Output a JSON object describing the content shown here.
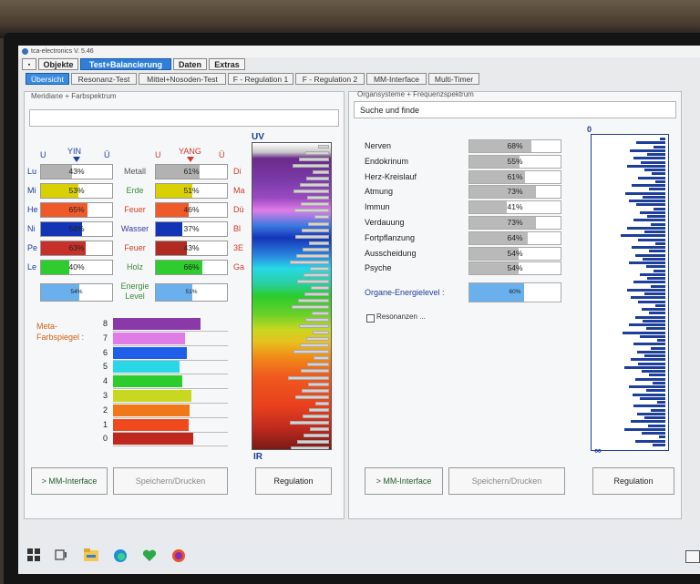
{
  "window": {
    "title": "tca-electronics  V. 5.46"
  },
  "menu": {
    "tabs": [
      "Objekte",
      "Test+Balancierung",
      "Daten",
      "Extras"
    ],
    "active": "Test+Balancierung"
  },
  "subtabs": {
    "items": [
      "Übersicht",
      "Resonanz-Test",
      "Mittel+Nosoden-Test",
      "F - Regulation 1",
      "F - Regulation 2",
      "MM-Interface",
      "Multi-Timer"
    ],
    "active": "Übersicht"
  },
  "left_panel": {
    "title": "Meridiane  +  Farbspektrum",
    "yin_header": "YIN",
    "yang_header": "YANG",
    "u_label": "U",
    "ue_label": "Ü",
    "rows": [
      {
        "left": "Lu",
        "yin": "43%",
        "yin_value": 0.43,
        "yin_color": "#b2b2b2",
        "mid": "Metall",
        "mid_color": "#555555",
        "yang": "61%",
        "yang_value": 0.61,
        "yang_color": "#b2b2b2",
        "right": "Di"
      },
      {
        "left": "Mi",
        "yin": "53%",
        "yin_value": 0.53,
        "yin_color": "#d8d000",
        "mid": "Erde",
        "mid_color": "#3a8a3a",
        "yang": "51%",
        "yang_value": 0.51,
        "yang_color": "#d8d000",
        "right": "Ma"
      },
      {
        "left": "He",
        "yin": "65%",
        "yin_value": 0.65,
        "yin_color": "#f05a2a",
        "mid": "Feuer",
        "mid_color": "#d6402a",
        "yang": "46%",
        "yang_value": 0.46,
        "yang_color": "#f05a2a",
        "right": "Dü"
      },
      {
        "left": "Ni",
        "yin": "58%",
        "yin_value": 0.58,
        "yin_color": "#1434b8",
        "mid": "Wasser",
        "mid_color": "#3a3aa0",
        "yang": "37%",
        "yang_value": 0.37,
        "yang_color": "#1434b8",
        "right": "Bl"
      },
      {
        "left": "Pe",
        "yin": "63%",
        "yin_value": 0.63,
        "yin_color": "#c8302a",
        "mid": "Feuer",
        "mid_color": "#d6402a",
        "yang": "43%",
        "yang_value": 0.43,
        "yang_color": "#b02a22",
        "right": "3E"
      },
      {
        "left": "Le",
        "yin": "40%",
        "yin_value": 0.4,
        "yin_color": "#2ecc2e",
        "mid": "Holz",
        "mid_color": "#3a8a3a",
        "yang": "66%",
        "yang_value": 0.66,
        "yang_color": "#2ecc2e",
        "right": "Ga"
      }
    ],
    "energy_label_1": "Energie",
    "energy_label_2": "Level",
    "energy_yin": "54%",
    "energy_yin_value": 0.54,
    "energy_yang": "51%",
    "energy_yang_value": 0.51,
    "meta_label_1": "Meta-",
    "meta_label_2": "Farbspiegel :",
    "meta_rows": [
      {
        "n": "8",
        "value": 0.76,
        "color": "#8a3aa8"
      },
      {
        "n": "7",
        "value": 0.63,
        "color": "#e07ce8"
      },
      {
        "n": "6",
        "value": 0.64,
        "color": "#1f5ee8"
      },
      {
        "n": "5",
        "value": 0.58,
        "color": "#28d8e6"
      },
      {
        "n": "4",
        "value": 0.6,
        "color": "#2ccc2c"
      },
      {
        "n": "3",
        "value": 0.68,
        "color": "#c8d820"
      },
      {
        "n": "2",
        "value": 0.67,
        "color": "#f07818"
      },
      {
        "n": "1",
        "value": 0.66,
        "color": "#ee4a1e"
      },
      {
        "n": "0",
        "value": 0.7,
        "color": "#c0281e"
      }
    ],
    "spectrum_top": "UV",
    "spectrum_bottom": "IR",
    "btn_mm": "> MM-Interface",
    "btn_save": "Speichern/Drucken",
    "btn_reg": "Regulation"
  },
  "right_panel": {
    "title": "Organsysteme  +  Frequenzspektrum",
    "search": "Suche und finde",
    "organs": [
      {
        "name": "Nerven",
        "pct": "68%",
        "value": 0.68
      },
      {
        "name": "Endokrinum",
        "pct": "55%",
        "value": 0.55
      },
      {
        "name": "Herz-Kreislauf",
        "pct": "61%",
        "value": 0.61
      },
      {
        "name": "Atmung",
        "pct": "73%",
        "value": 0.73
      },
      {
        "name": "Immun",
        "pct": "41%",
        "value": 0.41
      },
      {
        "name": "Verdauung",
        "pct": "73%",
        "value": 0.73
      },
      {
        "name": "Fortpflanzung",
        "pct": "64%",
        "value": 0.64
      },
      {
        "name": "Ausscheidung",
        "pct": "54%",
        "value": 0.54
      },
      {
        "name": "Psyche",
        "pct": "54%",
        "value": 0.54
      }
    ],
    "energy_label": "Organe-Energielevel :",
    "energy_pct": "60%",
    "energy_value": 0.6,
    "resonanzen": "Resonanzen ...",
    "freq_top": "0",
    "freq_bottom": "∞",
    "btn_mm": "> MM-Interface",
    "btn_save": "Speichern/Drucken",
    "btn_reg": "Regulation"
  },
  "taskbar": {
    "icons": [
      "windows-start-icon",
      "task-view-icon",
      "file-explorer-icon",
      "edge-browser-icon",
      "green-heart-app-icon",
      "firefox-icon"
    ]
  }
}
